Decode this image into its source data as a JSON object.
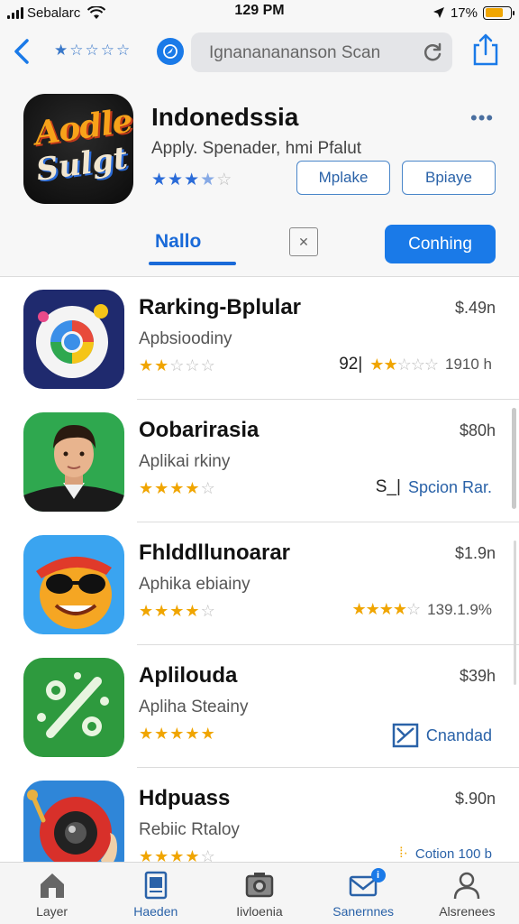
{
  "status_bar": {
    "carrier": "Sebalarc",
    "time": "129 PM",
    "battery": "17%",
    "battery_level": 0.72
  },
  "nav": {
    "rating_glyphs": "★☆☆☆☆",
    "search_text": "Ignananananson Scan"
  },
  "app": {
    "icon_line1": "Aodle",
    "icon_line2": "Sulgt",
    "title": "Indonedssia",
    "subtitle": "Apply. Spenader, hmi Pfalut",
    "rating": 3.5,
    "button_a": "Mplake",
    "button_b": "Bpiaye",
    "tab_active": "Nallo",
    "primary_button": "Conhing"
  },
  "list": [
    {
      "name": "Rarking-Bplular",
      "subtitle": "Apbsioodiny",
      "rating": 2,
      "price": "$.49n",
      "meta_num": "92|",
      "meta_rating": 2,
      "meta_text": "1910 h",
      "meta_link": ""
    },
    {
      "name": "Oobarirasia",
      "subtitle": "Aplikai rkiny",
      "rating": 4,
      "price": "$80h",
      "meta_num": "S_|",
      "meta_rating": 0,
      "meta_text": "",
      "meta_link": "Spcion Rar."
    },
    {
      "name": "Fhlddllunoarar",
      "subtitle": "Aphika ebiainy",
      "rating": 4,
      "price": "$1.9n",
      "meta_num": "",
      "meta_rating": 4,
      "meta_text": "139.1.9%",
      "meta_link": ""
    },
    {
      "name": "Aplilouda",
      "subtitle": "Apliha Steainy",
      "rating": 5,
      "price": "$39h",
      "meta_num": "",
      "meta_rating": 0,
      "meta_text": "",
      "meta_link": "Cnandad"
    },
    {
      "name": "Hdpuass",
      "subtitle": "Rebiic Rtaloy",
      "rating": 4,
      "price": "$.90n",
      "meta_num": "",
      "meta_rating": 0,
      "meta_text": "",
      "meta_link": "Cotion 100 b"
    }
  ],
  "tabbar": {
    "items": [
      {
        "label": "Layer",
        "icon": "home-icon"
      },
      {
        "label": "Haeden",
        "icon": "tablet-icon"
      },
      {
        "label": "Iivloenia",
        "icon": "camera-icon"
      },
      {
        "label": "Sanernnes",
        "icon": "mail-icon"
      },
      {
        "label": "Alsrenees",
        "icon": "person-icon"
      }
    ],
    "badge": "i"
  },
  "colors": {
    "accent": "#1a7ae8",
    "star": "#f0a500",
    "star_off": "#bdbdbd",
    "link": "#2a62a8"
  }
}
